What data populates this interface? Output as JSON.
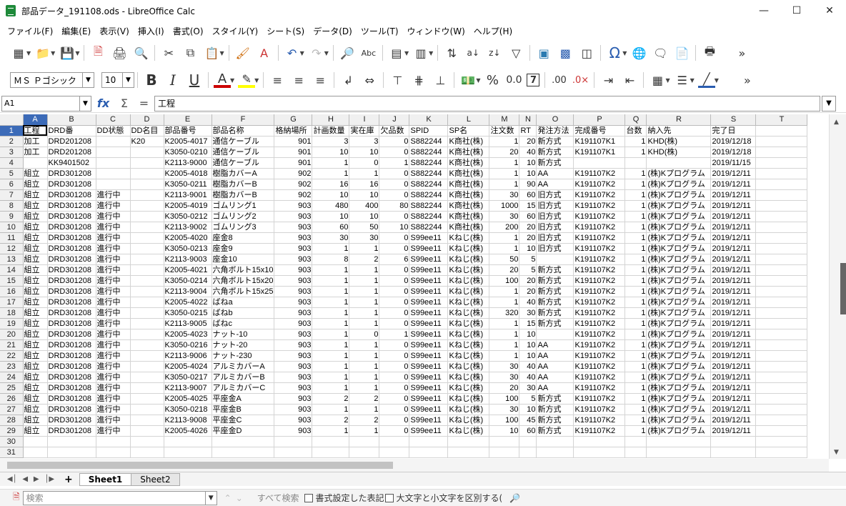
{
  "window": {
    "title": "部品データ_191108.ods - LibreOffice Calc"
  },
  "menu": [
    "ファイル(F)",
    "編集(E)",
    "表示(V)",
    "挿入(I)",
    "書式(O)",
    "スタイル(Y)",
    "シート(S)",
    "データ(D)",
    "ツール(T)",
    "ウィンドウ(W)",
    "ヘルプ(H)"
  ],
  "font": {
    "name": "ＭＳ Ｐゴシック",
    "size": "10"
  },
  "formula": {
    "cellref": "A1",
    "content": "工程"
  },
  "columns": [
    "A",
    "B",
    "C",
    "D",
    "E",
    "F",
    "G",
    "H",
    "I",
    "J",
    "K",
    "L",
    "M",
    "N",
    "O",
    "P",
    "Q",
    "R",
    "S",
    "T"
  ],
  "rows": [
    [
      "工程",
      "DRD番",
      "DD状態",
      "DD名目",
      "部品番号",
      "部品名称",
      "格納場所",
      "計画数量",
      "実在庫",
      "欠品数",
      "SPID",
      "SP名",
      "注文数",
      "RT",
      "発注方法",
      "完成番号",
      "台数",
      "納入先",
      "完了日",
      ""
    ],
    [
      "加工",
      "DRD201208",
      "",
      "K20",
      "K2005-4017",
      "通信ケーブル",
      "901",
      "3",
      "3",
      "0",
      "S882244",
      "K商社(株)",
      "1",
      "20",
      "新方式",
      "K191107K1",
      "1",
      "KHD(株)",
      "2019/12/18",
      ""
    ],
    [
      "加工",
      "DRD201208",
      "",
      "",
      "K3050-0210",
      "通信ケーブル",
      "901",
      "10",
      "10",
      "0",
      "S882244",
      "K商社(株)",
      "20",
      "40",
      "新方式",
      "K191107K1",
      "1",
      "KHD(株)",
      "2019/12/18",
      ""
    ],
    [
      "",
      "KK9401502",
      "",
      "",
      "K2113-9000",
      "通信ケーブル",
      "901",
      "1",
      "0",
      "1",
      "S882244",
      "K商社(株)",
      "1",
      "10",
      "新方式",
      "",
      "",
      "",
      "2019/11/15",
      ""
    ],
    [
      "組立",
      "DRD301208",
      "",
      "",
      "K2005-4018",
      "樹脂カバーA",
      "902",
      "1",
      "1",
      "0",
      "S882244",
      "K商社(株)",
      "1",
      "10",
      "AA",
      "K191107K2",
      "1",
      "(株)Kプログラム",
      "2019/12/11",
      ""
    ],
    [
      "組立",
      "DRD301208",
      "",
      "",
      "K3050-0211",
      "樹脂カバーB",
      "902",
      "16",
      "16",
      "0",
      "S882244",
      "K商社(株)",
      "1",
      "90",
      "AA",
      "K191107K2",
      "1",
      "(株)Kプログラム",
      "2019/12/11",
      ""
    ],
    [
      "組立",
      "DRD301208",
      "進行中",
      "",
      "K2113-9001",
      "樹脂カバーB",
      "902",
      "10",
      "10",
      "0",
      "S882244",
      "K商社(株)",
      "30",
      "60",
      "旧方式",
      "K191107K2",
      "1",
      "(株)Kプログラム",
      "2019/12/11",
      ""
    ],
    [
      "組立",
      "DRD301208",
      "進行中",
      "",
      "K2005-4019",
      "ゴムリング1",
      "903",
      "480",
      "400",
      "80",
      "S882244",
      "K商社(株)",
      "1000",
      "15",
      "旧方式",
      "K191107K2",
      "1",
      "(株)Kプログラム",
      "2019/12/11",
      ""
    ],
    [
      "組立",
      "DRD301208",
      "進行中",
      "",
      "K3050-0212",
      "ゴムリング2",
      "903",
      "10",
      "10",
      "0",
      "S882244",
      "K商社(株)",
      "30",
      "60",
      "旧方式",
      "K191107K2",
      "1",
      "(株)Kプログラム",
      "2019/12/11",
      ""
    ],
    [
      "組立",
      "DRD301208",
      "進行中",
      "",
      "K2113-9002",
      "ゴムリング3",
      "903",
      "60",
      "50",
      "10",
      "S882244",
      "K商社(株)",
      "200",
      "20",
      "旧方式",
      "K191107K2",
      "1",
      "(株)Kプログラム",
      "2019/12/11",
      ""
    ],
    [
      "組立",
      "DRD301208",
      "進行中",
      "",
      "K2005-4020",
      "座金8",
      "903",
      "30",
      "30",
      "0",
      "S99ee11",
      "Kねじ(株)",
      "1",
      "20",
      "旧方式",
      "K191107K2",
      "1",
      "(株)Kプログラム",
      "2019/12/11",
      ""
    ],
    [
      "組立",
      "DRD301208",
      "進行中",
      "",
      "K3050-0213",
      "座金9",
      "903",
      "1",
      "1",
      "0",
      "S99ee11",
      "Kねじ(株)",
      "1",
      "10",
      "旧方式",
      "K191107K2",
      "1",
      "(株)Kプログラム",
      "2019/12/11",
      ""
    ],
    [
      "組立",
      "DRD301208",
      "進行中",
      "",
      "K2113-9003",
      "座金10",
      "903",
      "8",
      "2",
      "6",
      "S99ee11",
      "Kねじ(株)",
      "50",
      "5",
      "",
      "K191107K2",
      "1",
      "(株)Kプログラム",
      "2019/12/11",
      ""
    ],
    [
      "組立",
      "DRD301208",
      "進行中",
      "",
      "K2005-4021",
      "六角ボルト15x10",
      "903",
      "1",
      "1",
      "0",
      "S99ee11",
      "Kねじ(株)",
      "20",
      "5",
      "新方式",
      "K191107K2",
      "1",
      "(株)Kプログラム",
      "2019/12/11",
      ""
    ],
    [
      "組立",
      "DRD301208",
      "進行中",
      "",
      "K3050-0214",
      "六角ボルト15x20",
      "903",
      "1",
      "1",
      "0",
      "S99ee11",
      "Kねじ(株)",
      "100",
      "20",
      "新方式",
      "K191107K2",
      "1",
      "(株)Kプログラム",
      "2019/12/11",
      ""
    ],
    [
      "組立",
      "DRD301208",
      "進行中",
      "",
      "K2113-9004",
      "六角ボルト15x25",
      "903",
      "1",
      "1",
      "0",
      "S99ee11",
      "Kねじ(株)",
      "1",
      "20",
      "新方式",
      "K191107K2",
      "1",
      "(株)Kプログラム",
      "2019/12/11",
      ""
    ],
    [
      "組立",
      "DRD301208",
      "進行中",
      "",
      "K2005-4022",
      "ばねa",
      "903",
      "1",
      "1",
      "0",
      "S99ee11",
      "Kねじ(株)",
      "1",
      "40",
      "新方式",
      "K191107K2",
      "1",
      "(株)Kプログラム",
      "2019/12/11",
      ""
    ],
    [
      "組立",
      "DRD301208",
      "進行中",
      "",
      "K3050-0215",
      "ばねb",
      "903",
      "1",
      "1",
      "0",
      "S99ee11",
      "Kねじ(株)",
      "320",
      "30",
      "新方式",
      "K191107K2",
      "1",
      "(株)Kプログラム",
      "2019/12/11",
      ""
    ],
    [
      "組立",
      "DRD301208",
      "進行中",
      "",
      "K2113-9005",
      "ばねc",
      "903",
      "1",
      "1",
      "0",
      "S99ee11",
      "Kねじ(株)",
      "1",
      "15",
      "新方式",
      "K191107K2",
      "1",
      "(株)Kプログラム",
      "2019/12/11",
      ""
    ],
    [
      "組立",
      "DRD301208",
      "進行中",
      "",
      "K2005-4023",
      "ナット-10",
      "903",
      "1",
      "0",
      "1",
      "S99ee11",
      "Kねじ(株)",
      "1",
      "10",
      "",
      "K191107K2",
      "1",
      "(株)Kプログラム",
      "2019/12/11",
      ""
    ],
    [
      "組立",
      "DRD301208",
      "進行中",
      "",
      "K3050-0216",
      "ナット-20",
      "903",
      "1",
      "1",
      "0",
      "S99ee11",
      "Kねじ(株)",
      "1",
      "10",
      "AA",
      "K191107K2",
      "1",
      "(株)Kプログラム",
      "2019/12/11",
      ""
    ],
    [
      "組立",
      "DRD301208",
      "進行中",
      "",
      "K2113-9006",
      "ナット-230",
      "903",
      "1",
      "1",
      "0",
      "S99ee11",
      "Kねじ(株)",
      "1",
      "10",
      "AA",
      "K191107K2",
      "1",
      "(株)Kプログラム",
      "2019/12/11",
      ""
    ],
    [
      "組立",
      "DRD301208",
      "進行中",
      "",
      "K2005-4024",
      "アルミカバーA",
      "903",
      "1",
      "1",
      "0",
      "S99ee11",
      "Kねじ(株)",
      "30",
      "40",
      "AA",
      "K191107K2",
      "1",
      "(株)Kプログラム",
      "2019/12/11",
      ""
    ],
    [
      "組立",
      "DRD301208",
      "進行中",
      "",
      "K3050-0217",
      "アルミカバーB",
      "903",
      "1",
      "1",
      "0",
      "S99ee11",
      "Kねじ(株)",
      "30",
      "40",
      "AA",
      "K191107K2",
      "1",
      "(株)Kプログラム",
      "2019/12/11",
      ""
    ],
    [
      "組立",
      "DRD301208",
      "進行中",
      "",
      "K2113-9007",
      "アルミカバーC",
      "903",
      "1",
      "1",
      "0",
      "S99ee11",
      "Kねじ(株)",
      "20",
      "30",
      "AA",
      "K191107K2",
      "1",
      "(株)Kプログラム",
      "2019/12/11",
      ""
    ],
    [
      "組立",
      "DRD301208",
      "進行中",
      "",
      "K2005-4025",
      "平座金A",
      "903",
      "2",
      "2",
      "0",
      "S99ee11",
      "Kねじ(株)",
      "100",
      "5",
      "新方式",
      "K191107K2",
      "1",
      "(株)Kプログラム",
      "2019/12/11",
      ""
    ],
    [
      "組立",
      "DRD301208",
      "進行中",
      "",
      "K3050-0218",
      "平座金B",
      "903",
      "1",
      "1",
      "0",
      "S99ee11",
      "Kねじ(株)",
      "30",
      "10",
      "新方式",
      "K191107K2",
      "1",
      "(株)Kプログラム",
      "2019/12/11",
      ""
    ],
    [
      "組立",
      "DRD301208",
      "進行中",
      "",
      "K2113-9008",
      "平座金C",
      "903",
      "2",
      "2",
      "0",
      "S99ee11",
      "Kねじ(株)",
      "100",
      "45",
      "新方式",
      "K191107K2",
      "1",
      "(株)Kプログラム",
      "2019/12/11",
      ""
    ],
    [
      "組立",
      "DRD301208",
      "進行中",
      "",
      "K2005-4026",
      "平座金D",
      "903",
      "1",
      "1",
      "0",
      "S99ee11",
      "Kねじ(株)",
      "10",
      "60",
      "新方式",
      "K191107K2",
      "1",
      "(株)Kプログラム",
      "2019/12/11",
      ""
    ],
    [
      "",
      "",
      "",
      "",
      "",
      "",
      "",
      "",
      "",
      "",
      "",
      "",
      "",
      "",
      "",
      "",
      "",
      "",
      "",
      ""
    ],
    [
      "",
      "",
      "",
      "",
      "",
      "",
      "",
      "",
      "",
      "",
      "",
      "",
      "",
      "",
      "",
      "",
      "",
      "",
      "",
      ""
    ]
  ],
  "numeric_cols": [
    6,
    7,
    8,
    9,
    12,
    13,
    16
  ],
  "sheets": [
    "Sheet1",
    "Sheet2"
  ],
  "findbar": {
    "placeholder": "検索",
    "find_all": "すべて検索",
    "opt1": "書式設定した表記",
    "opt2": "大文字と小文字を区別する("
  }
}
